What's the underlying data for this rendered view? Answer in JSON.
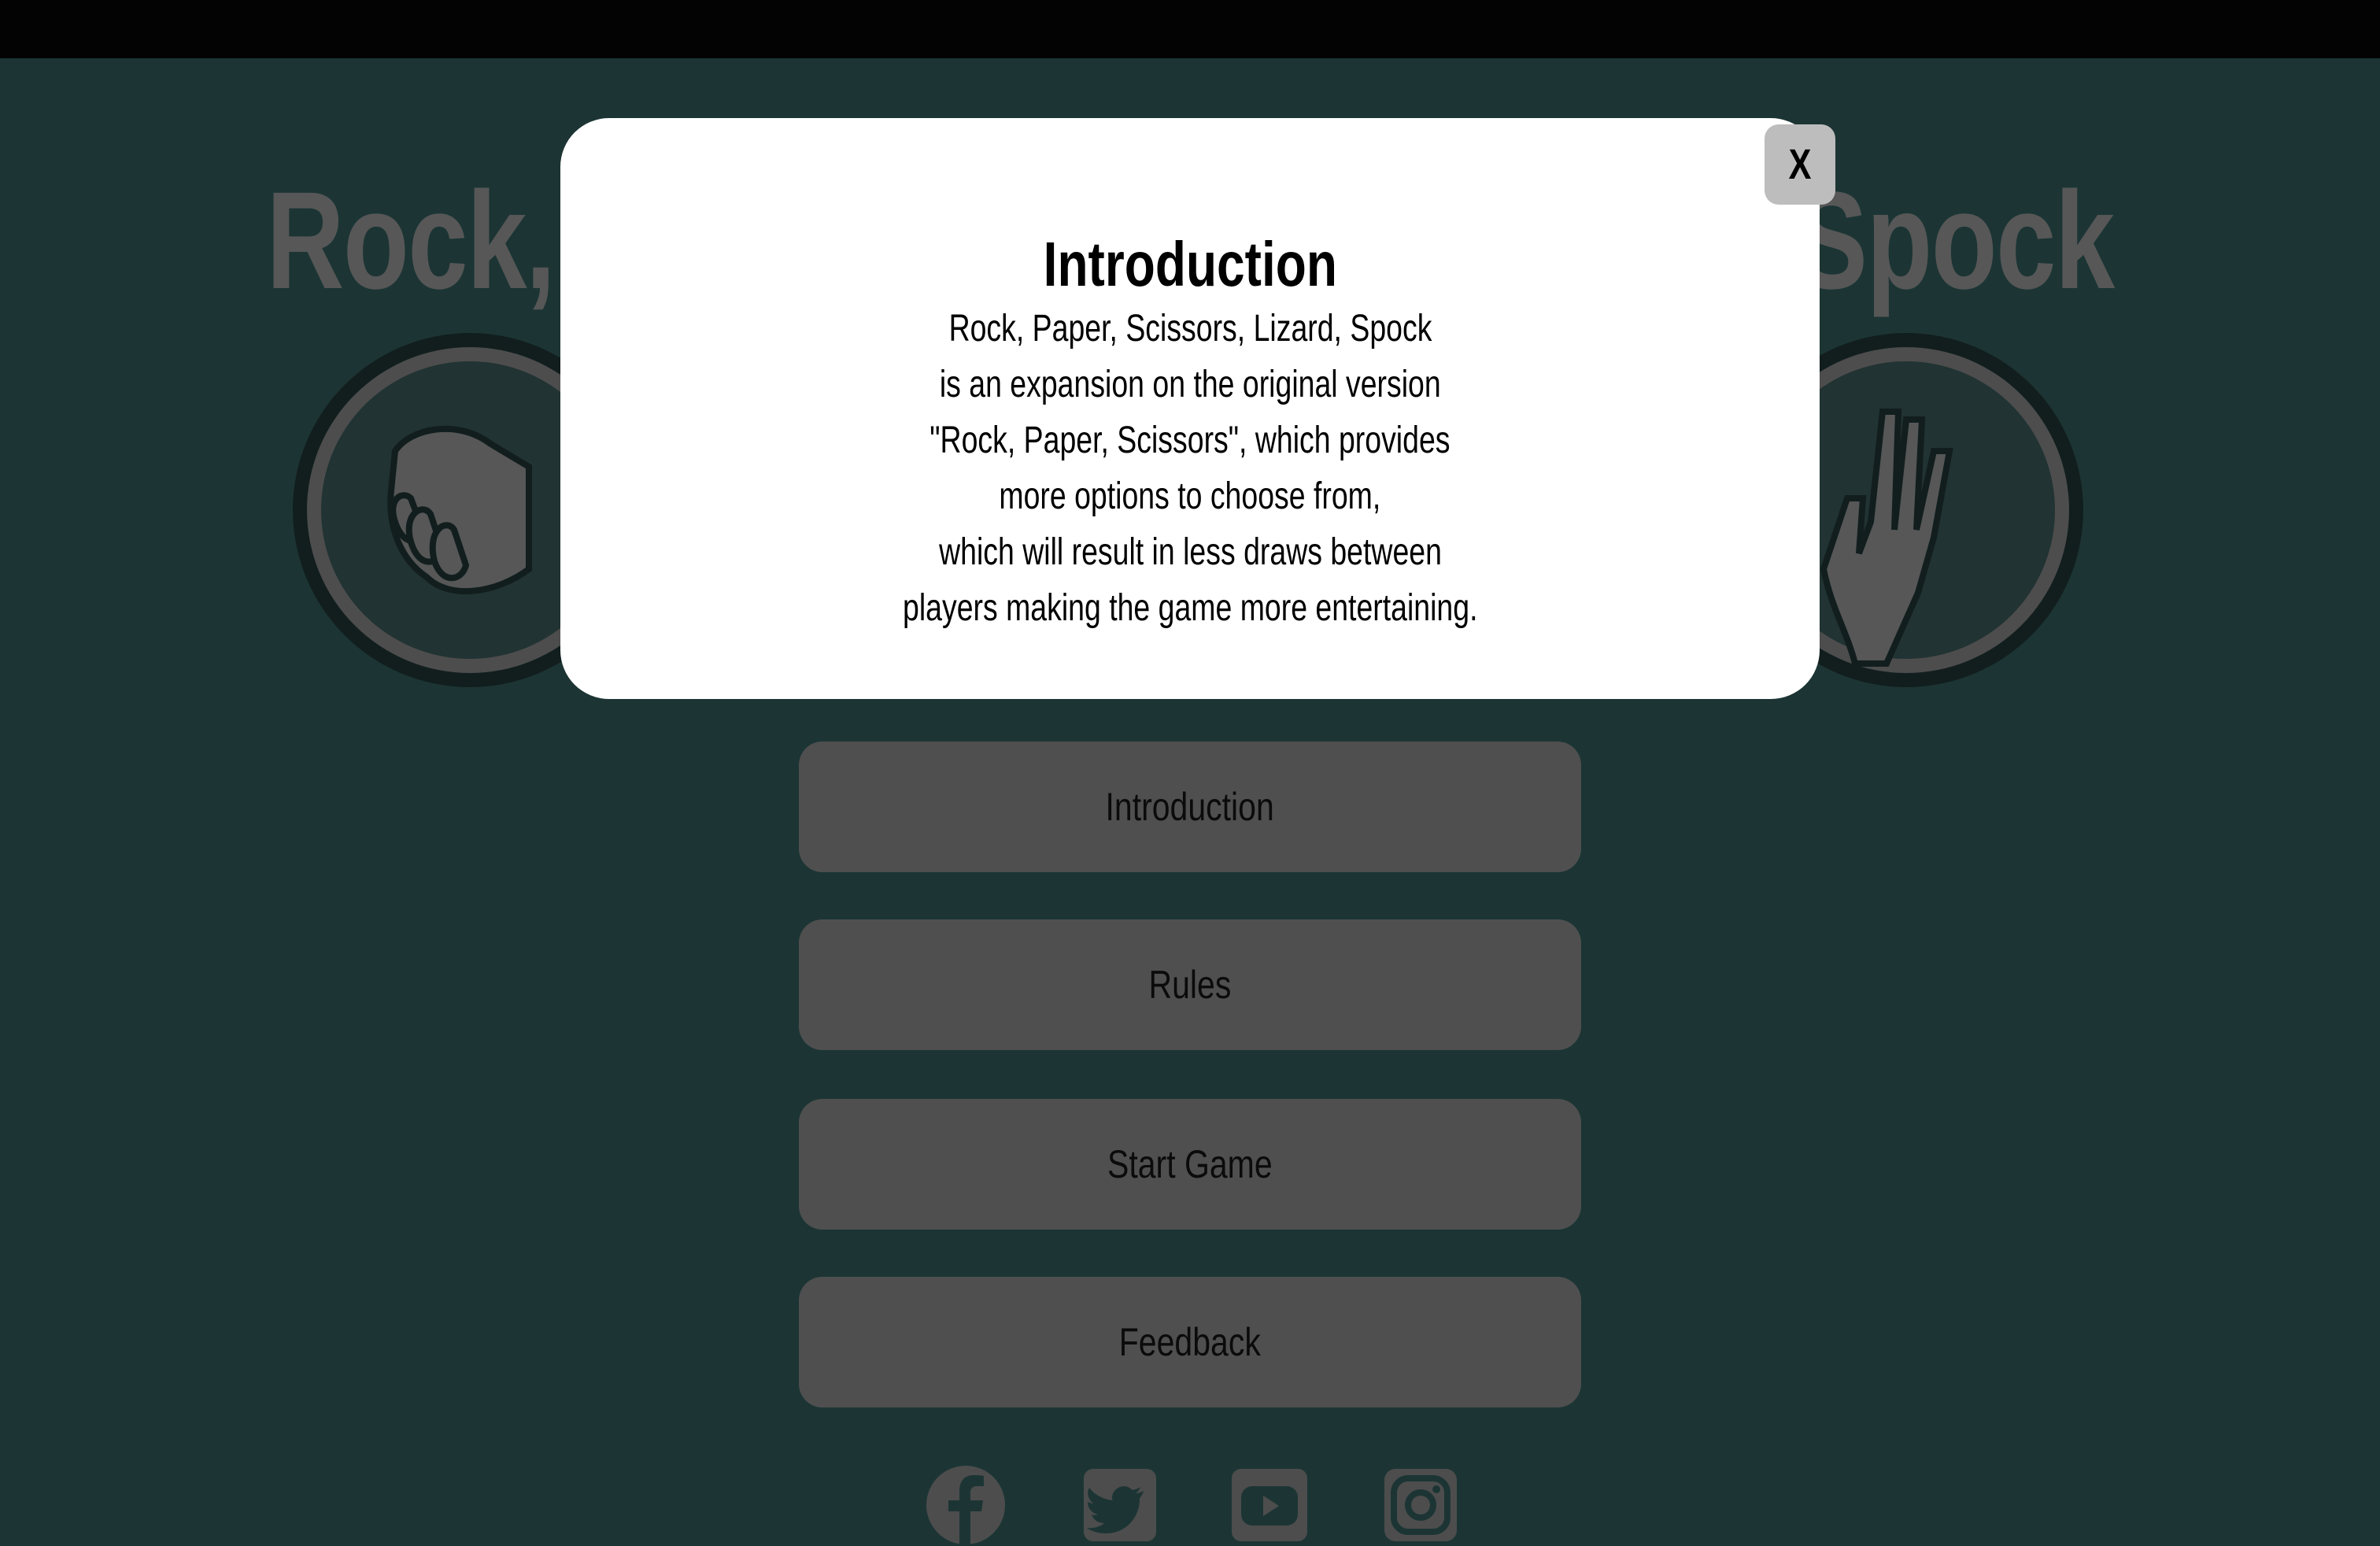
{
  "page": {
    "title": "Rock, Paper, Scissors, Lizard, Spock"
  },
  "menu": {
    "introduction": "Introduction",
    "rules": "Rules",
    "start_game": "Start Game",
    "feedback": "Feedback"
  },
  "modal": {
    "title": "Introduction",
    "close_label": "X",
    "lines": [
      "Rock, Paper, Scissors, Lizard, Spock",
      "is an expansion on the original version",
      "\"Rock, Paper, Scissors\", which provides",
      "more options to choose from,",
      "which will result in less draws between",
      "players making the game more entertaining."
    ]
  },
  "social": [
    "facebook-icon",
    "twitter-icon",
    "youtube-icon",
    "instagram-icon"
  ],
  "colors": {
    "background": "#1c3534",
    "overlay_text": "#575757",
    "button": "#4f4f4f",
    "modal": "#ffffff",
    "close_button": "#bdbdbd"
  }
}
